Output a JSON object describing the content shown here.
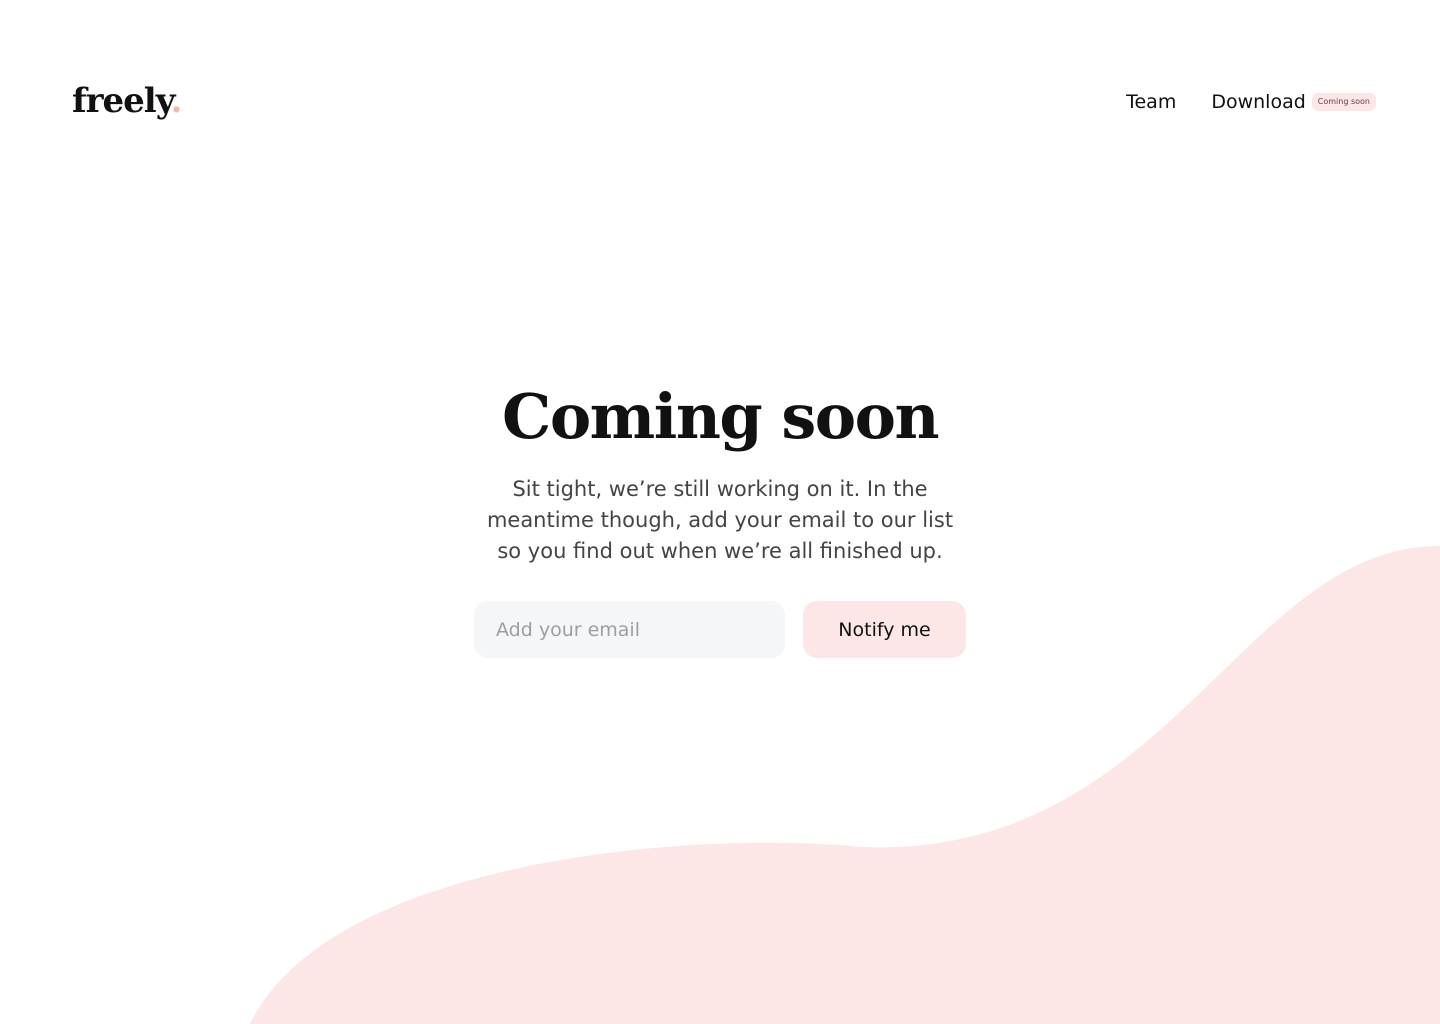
{
  "brand": {
    "logo_text": "freely",
    "logo_dot": ".",
    "accent_color": "#f5b7b2",
    "soft_pink": "#fde6e6"
  },
  "nav": {
    "team_label": "Team",
    "download_label": "Download",
    "download_badge": "Coming soon"
  },
  "hero": {
    "title": "Coming soon",
    "subtitle": "Sit tight, we’re still working on it. In the meantime though, add your email to our list so you find out when we’re all finished up."
  },
  "form": {
    "email_placeholder": "Add your email",
    "email_value": "",
    "submit_label": "Notify me"
  }
}
